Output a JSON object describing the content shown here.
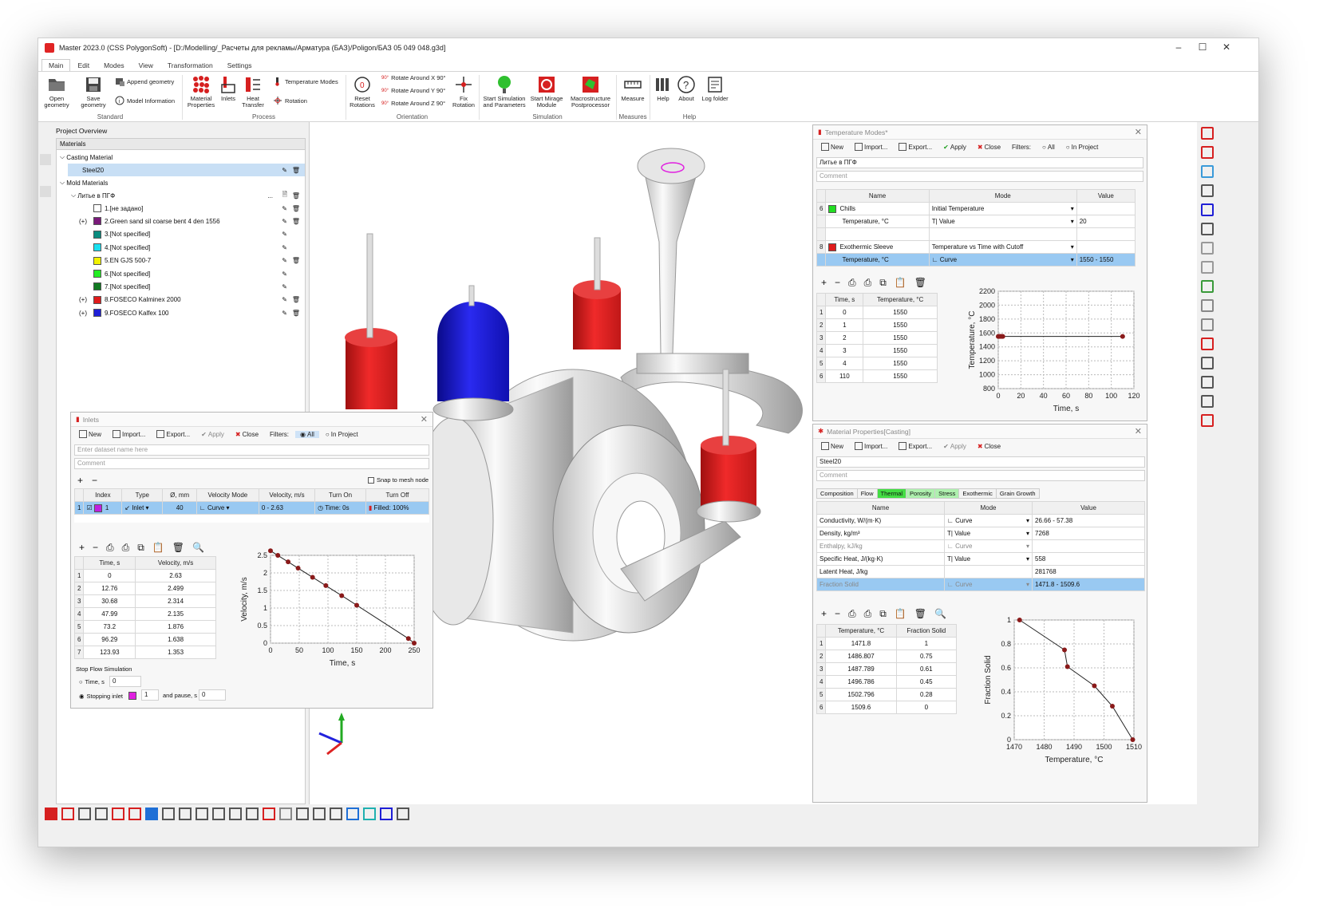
{
  "window": {
    "title": "Master 2023.0 (CSS PolygonSoft) - [D:/Modelling/_Расчеты для рекламы/Арматура (БАЗ)/Poligon/БАЗ 05 049 048.g3d]"
  },
  "menu_tabs": [
    "Main",
    "Edit",
    "Modes",
    "View",
    "Transformation",
    "Settings"
  ],
  "ribbon": {
    "open_geometry": "Open\ngeometry",
    "save_geometry": "Save\ngeometry",
    "append_geometry": "Append geometry",
    "model_information": "Model Information",
    "material_properties": "Material\nProperties",
    "inlets": "Inlets",
    "heat_transfer": "Heat\nTransfer",
    "temperature_modes": "Temperature Modes",
    "rotation": "Rotation",
    "reset_rotations": "Reset\nRotations",
    "rotate_x": "Rotate Around X 90°",
    "rotate_y": "Rotate Around Y 90°",
    "rotate_z": "Rotate Around Z 90°",
    "fix_rotation": "Fix\nRotation",
    "start_simulation": "Start Simulation\nand Parameters",
    "start_mirage": "Start Mirage\nModule",
    "macrostructure": "Macrostructure\nPostprocessor",
    "measure": "Measure",
    "help": "Help",
    "about": "About",
    "log_folder": "Log folder",
    "groups": [
      "Standard",
      "Process",
      "Orientation",
      "Simulation",
      "Measures",
      "Help"
    ],
    "angle_badge": "90°"
  },
  "project_overview": {
    "title": "Project Overview",
    "header": "Materials",
    "casting_material": "Casting Material",
    "steel": "Steel20",
    "mold_materials": "Mold Materials",
    "mold_group": "Литье в ПГФ",
    "ellipsis": "...",
    "plus_badge": "(+)",
    "items": [
      {
        "label": "1.[не задано]",
        "color": "#ffffff",
        "plus": false
      },
      {
        "label": "2.Green sand sil coarse bent 4 den 1556",
        "color": "#7a1a7a",
        "plus": true
      },
      {
        "label": "3.[Not specified]",
        "color": "#0a8c7f",
        "plus": false
      },
      {
        "label": "4.[Not specified]",
        "color": "#19e0f0",
        "plus": false
      },
      {
        "label": "5.EN GJS 500-7",
        "color": "#f2f200",
        "plus": false
      },
      {
        "label": "6.[Not specified]",
        "color": "#22ee22",
        "plus": false
      },
      {
        "label": "7.[Not specified]",
        "color": "#117a22",
        "plus": false
      },
      {
        "label": "8.FOSECO Kalminex 2000",
        "color": "#e01b1b",
        "plus": true
      },
      {
        "label": "9.FOSECO Kalfex 100",
        "color": "#1f1fd6",
        "plus": true
      }
    ]
  },
  "inlets": {
    "title": "Inlets",
    "new": "New",
    "import": "Import...",
    "export": "Export...",
    "apply": "Apply",
    "close": "Close",
    "filters": "Filters:",
    "all": "All",
    "in_project": "In Project",
    "name_placeholder": "Enter dataset name here",
    "comment_placeholder": "Comment",
    "snap": "Snap to mesh node",
    "columns": [
      "Index",
      "Type",
      "Ø, mm",
      "Velocity Mode",
      "Velocity, m/s",
      "Turn On",
      "Turn Off"
    ],
    "row": {
      "n": "1",
      "index": "1",
      "type": "Inlet",
      "d": "40",
      "mode": "Curve",
      "velocity": "0 - 2.63",
      "on": "Time: 0s",
      "off": "Filled: 100%"
    },
    "curve_cols": [
      "Time, s",
      "Velocity, m/s"
    ],
    "curve_rows": [
      [
        "0",
        "2.63"
      ],
      [
        "12.76",
        "2.499"
      ],
      [
        "30.68",
        "2.314"
      ],
      [
        "47.99",
        "2.135"
      ],
      [
        "73.2",
        "1.876"
      ],
      [
        "96.29",
        "1.638"
      ],
      [
        "123.93",
        "1.353"
      ]
    ],
    "stop_flow": "Stop Flow Simulation",
    "time_s": "Time, s",
    "time_val": "0",
    "stopping_inlet": "Stopping inlet",
    "stopping_val": "1",
    "and_pause": "and pause, s",
    "pause_val": "0"
  },
  "temp_modes": {
    "title": "Temperature Modes*",
    "new": "New",
    "import": "Import...",
    "export": "Export...",
    "apply": "Apply",
    "close": "Close",
    "filters": "Filters:",
    "all": "All",
    "in_project": "In Project",
    "name": "Литье в ПГФ",
    "comment_placeholder": "Comment",
    "columns": [
      "Name",
      "Mode",
      "Value"
    ],
    "rows": [
      {
        "n": "6",
        "name": "Chills",
        "color": "#22dd22",
        "mode": "Initial Temperature",
        "value": ""
      },
      {
        "n": "",
        "name": "Temperature, °C",
        "color": "",
        "mode": "Value",
        "value": "20"
      },
      {
        "n": "",
        "name": "",
        "color": "",
        "mode": "",
        "value": ""
      },
      {
        "n": "8",
        "name": "Exothermic Sleeve",
        "color": "#e01b1b",
        "mode": "Temperature vs Time with Cutoff",
        "value": ""
      },
      {
        "n": "",
        "name": "Temperature, °C",
        "color": "",
        "mode": "Curve",
        "value": "1550 - 1550"
      }
    ],
    "curve_cols": [
      "Time, s",
      "Temperature, °C"
    ],
    "curve_rows": [
      [
        "0",
        "1550"
      ],
      [
        "1",
        "1550"
      ],
      [
        "2",
        "1550"
      ],
      [
        "3",
        "1550"
      ],
      [
        "4",
        "1550"
      ],
      [
        "110",
        "1550"
      ]
    ]
  },
  "material_props": {
    "title": "Material Properties[Casting]",
    "new": "New",
    "import": "Import...",
    "export": "Export...",
    "apply": "Apply",
    "close": "Close",
    "name": "Steel20",
    "comment_placeholder": "Comment",
    "tabs": [
      "Composition",
      "Flow",
      "Thermal",
      "Porosity",
      "Stress",
      "Exothermic",
      "Grain Growth"
    ],
    "columns": [
      "Name",
      "Mode",
      "Value"
    ],
    "rows": [
      {
        "name": "Conductivity, W/(m·K)",
        "mode": "Curve",
        "value": "26.66 - 57.38"
      },
      {
        "name": "Density, kg/m³",
        "mode": "Value",
        "value": "7268"
      },
      {
        "name": "Enthalpy, kJ/kg",
        "mode": "Curve",
        "value": ""
      },
      {
        "name": "Specific Heat, J/(kg·K)",
        "mode": "Value",
        "value": "558"
      },
      {
        "name": "Latent Heat, J/kg",
        "mode": "",
        "value": "281768"
      },
      {
        "name": "Fraction Solid",
        "mode": "Curve",
        "value": "1471.8 - 1509.6"
      }
    ],
    "curve_cols": [
      "Temperature, °C",
      "Fraction Solid"
    ],
    "curve_rows": [
      [
        "1471.8",
        "1"
      ],
      [
        "1486.807",
        "0.75"
      ],
      [
        "1487.789",
        "0.61"
      ],
      [
        "1496.786",
        "0.45"
      ],
      [
        "1502.796",
        "0.28"
      ],
      [
        "1509.6",
        "0"
      ]
    ]
  },
  "chart_data": [
    {
      "type": "line",
      "xlabel": "Time, s",
      "ylabel": "Velocity, m/s",
      "x": [
        0,
        12.76,
        30.68,
        47.99,
        73.2,
        96.29,
        123.93,
        150,
        240,
        250
      ],
      "y": [
        2.63,
        2.499,
        2.314,
        2.135,
        1.876,
        1.638,
        1.353,
        1.08,
        0.13,
        0
      ],
      "xlim": [
        0,
        250
      ],
      "ylim": [
        0,
        2.5
      ],
      "xticks": [
        0,
        50,
        100,
        150,
        200,
        250
      ],
      "yticks": [
        0,
        0.5,
        1,
        1.5,
        2,
        2.5
      ],
      "grid": true
    },
    {
      "type": "line",
      "xlabel": "Time, s",
      "ylabel": "Temperature, °C",
      "x": [
        0,
        1,
        2,
        3,
        4,
        110
      ],
      "y": [
        1550,
        1550,
        1550,
        1550,
        1550,
        1550
      ],
      "xlim": [
        0,
        120
      ],
      "ylim": [
        800,
        2200
      ],
      "xticks": [
        0,
        20,
        40,
        60,
        80,
        100,
        120
      ],
      "yticks": [
        800,
        1000,
        1200,
        1400,
        1600,
        1800,
        2000,
        2200
      ],
      "grid": true
    },
    {
      "type": "line",
      "xlabel": "Temperature, °C",
      "ylabel": "Fraction Solid",
      "x": [
        1471.8,
        1486.807,
        1487.789,
        1496.786,
        1502.796,
        1509.6
      ],
      "y": [
        1,
        0.75,
        0.61,
        0.45,
        0.28,
        0
      ],
      "xlim": [
        1470,
        1510
      ],
      "ylim": [
        0,
        1
      ],
      "xticks": [
        1470,
        1480,
        1490,
        1500,
        1510
      ],
      "yticks": [
        0,
        0.2,
        0.4,
        0.6,
        0.8,
        1
      ],
      "grid": true
    }
  ]
}
